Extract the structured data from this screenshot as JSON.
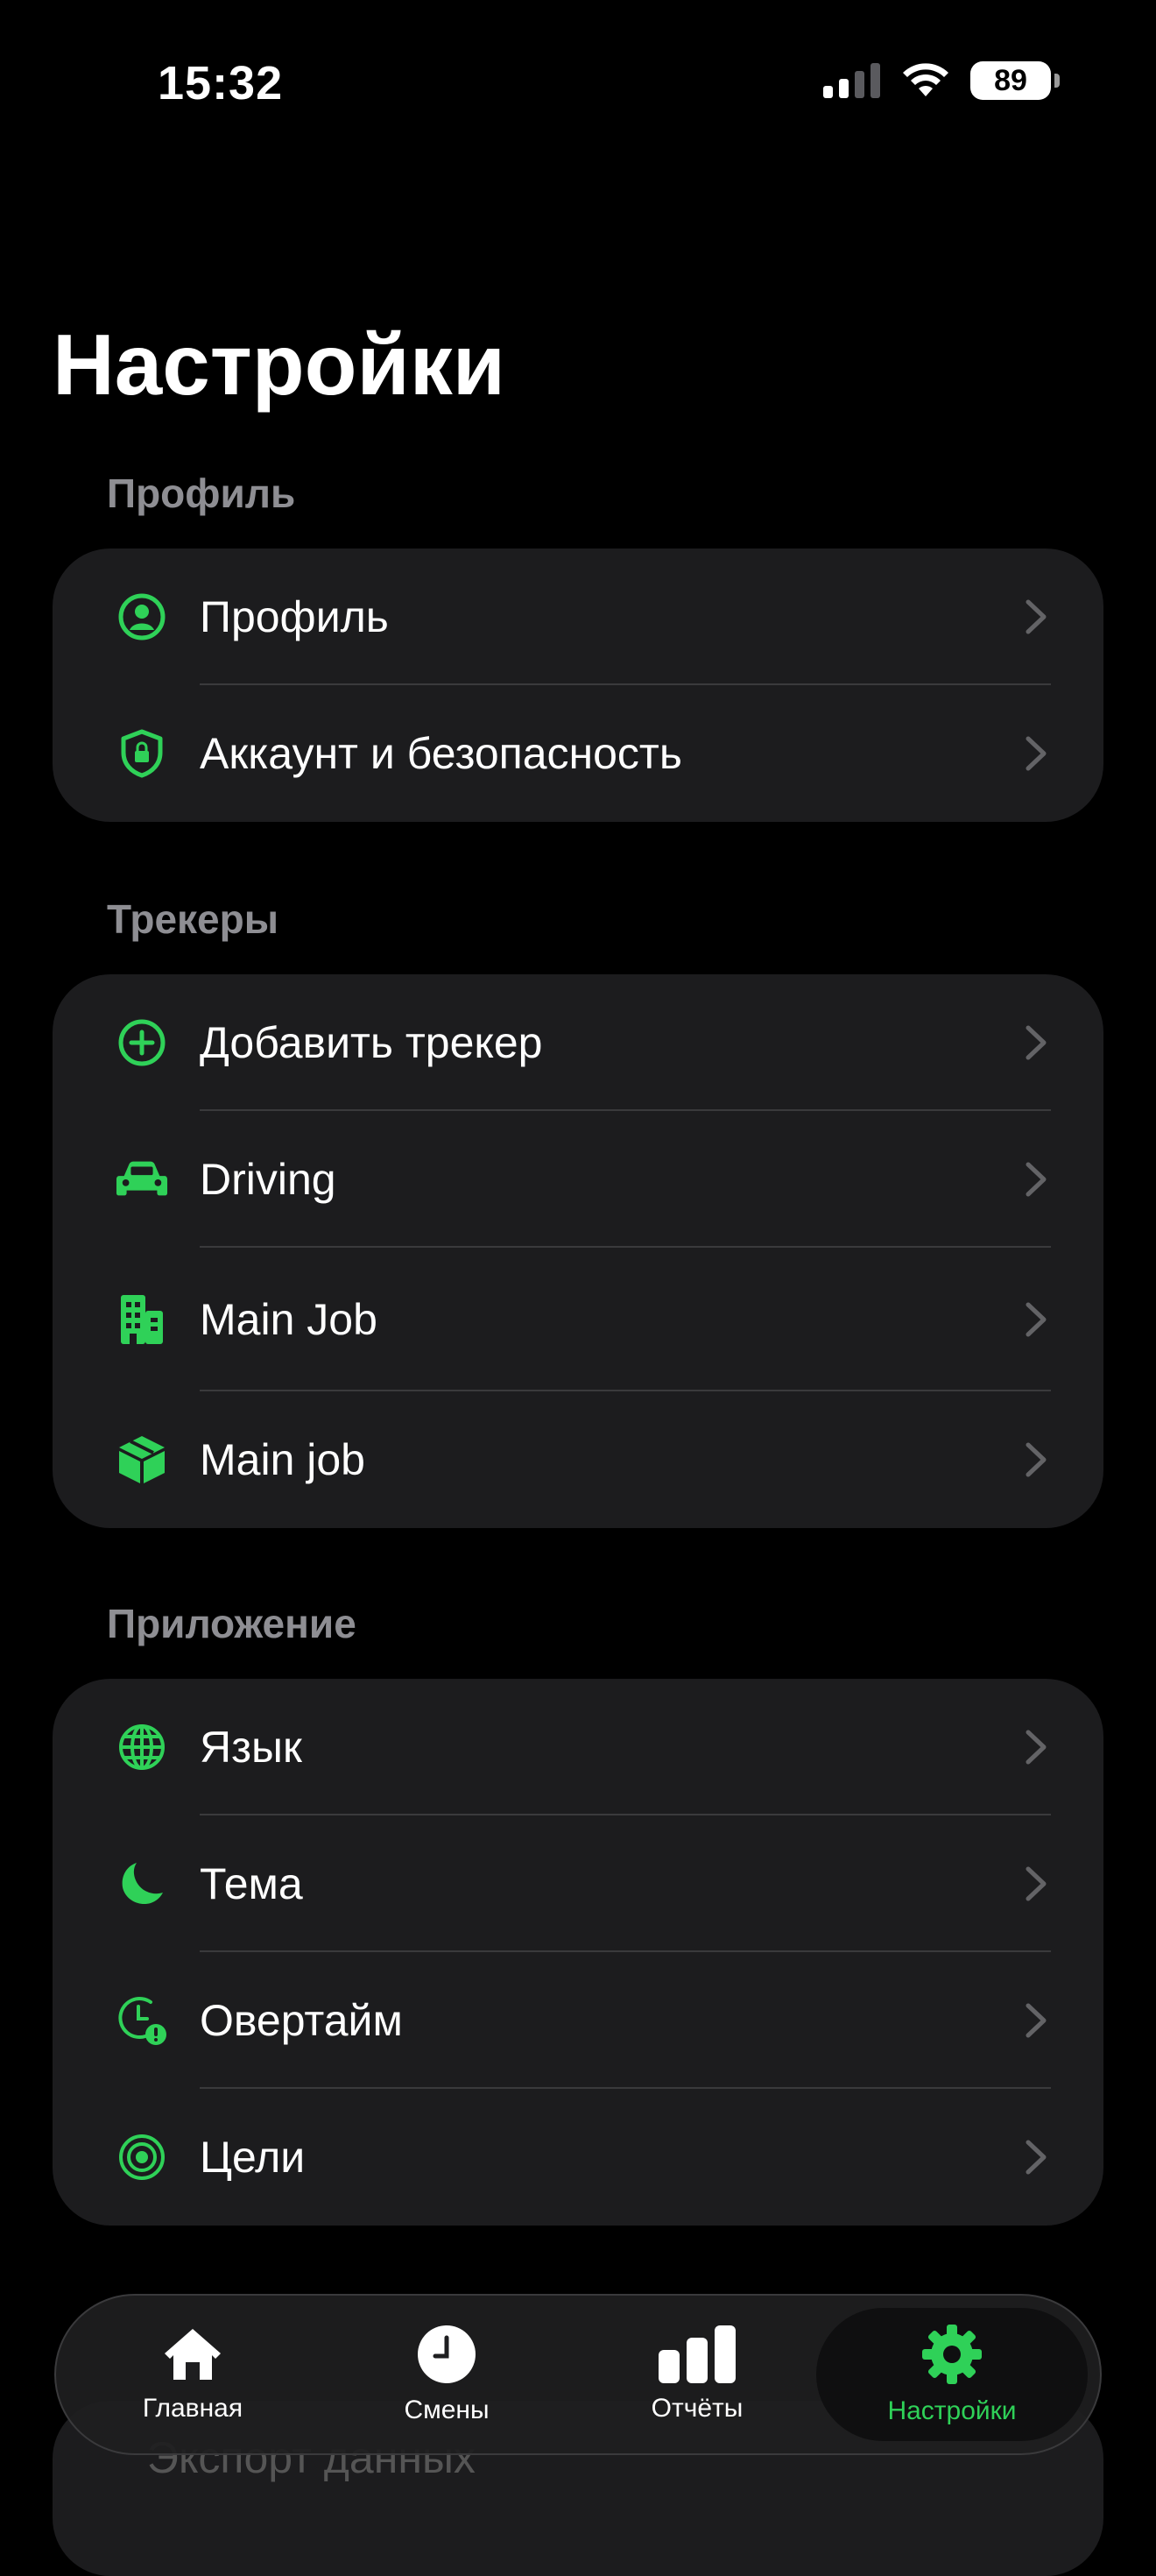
{
  "status": {
    "time": "15:32",
    "battery": "89"
  },
  "page": {
    "title": "Настройки"
  },
  "sections": {
    "profile": {
      "header": "Профиль",
      "items": [
        {
          "label": "Профиль",
          "icon": "person-circle-icon"
        },
        {
          "label": "Аккаунт и безопасность",
          "icon": "shield-lock-icon"
        }
      ]
    },
    "trackers": {
      "header": "Трекеры",
      "items": [
        {
          "label": "Добавить трекер",
          "icon": "plus-circle-icon"
        },
        {
          "label": "Driving",
          "icon": "car-icon"
        },
        {
          "label": "Main Job",
          "icon": "building-icon"
        },
        {
          "label": "Main job",
          "icon": "box-icon"
        }
      ]
    },
    "app": {
      "header": "Приложение",
      "items": [
        {
          "label": "Язык",
          "icon": "globe-icon"
        },
        {
          "label": "Тема",
          "icon": "moon-icon"
        },
        {
          "label": "Овертайм",
          "icon": "clock-alert-icon"
        },
        {
          "label": "Цели",
          "icon": "target-icon"
        }
      ]
    },
    "data": {
      "partial_label": "Экспорт данных"
    }
  },
  "tabbar": {
    "tabs": [
      {
        "label": "Главная",
        "icon": "house-icon"
      },
      {
        "label": "Смены",
        "icon": "clock-icon"
      },
      {
        "label": "Отчёты",
        "icon": "bar-chart-icon"
      },
      {
        "label": "Настройки",
        "icon": "gear-icon",
        "active": true
      }
    ]
  },
  "colors": {
    "accent": "#2fd158",
    "card": "#1c1c1e",
    "background": "#000000",
    "secondary_text": "#8e8e93"
  }
}
